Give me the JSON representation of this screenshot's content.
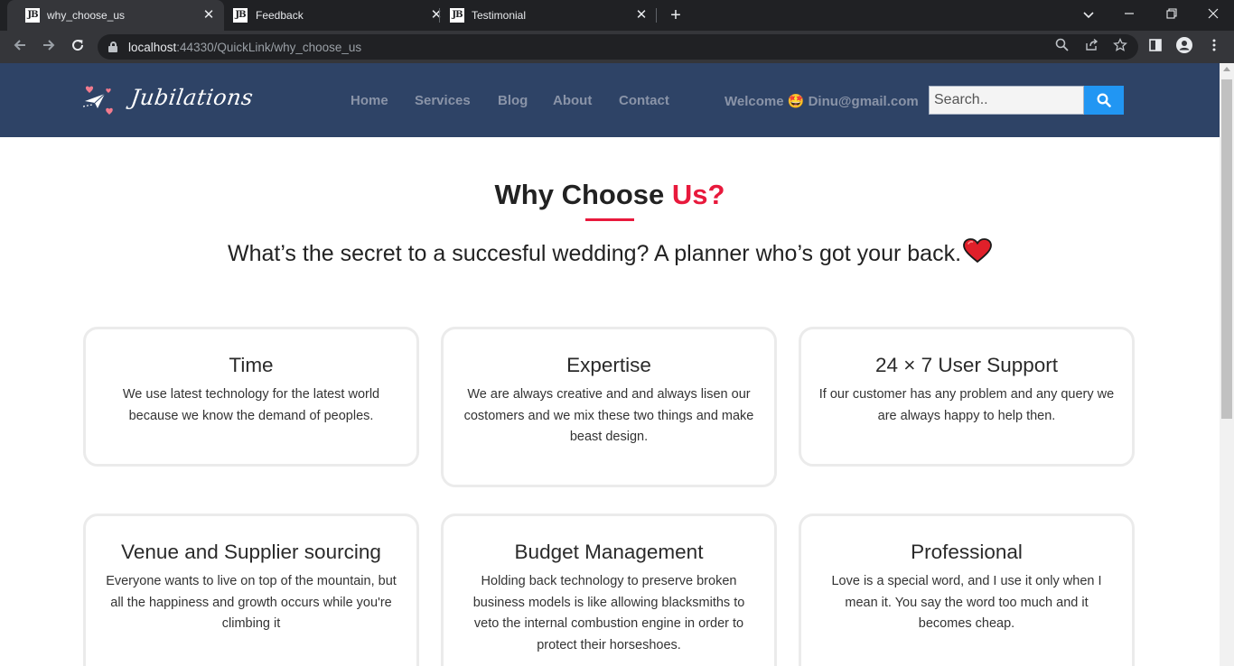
{
  "browser": {
    "tabs": [
      {
        "favicon": "JB",
        "title": "why_choose_us"
      },
      {
        "favicon": "JB",
        "title": "Feedback"
      },
      {
        "favicon": "JB",
        "title": "Testimonial"
      }
    ],
    "url_host": "localhost",
    "url_rest": ":44330/QuickLink/why_choose_us"
  },
  "site": {
    "logo_text": "Jubilations",
    "nav": [
      "Home",
      "Services",
      "Blog",
      "About",
      "Contact"
    ],
    "welcome": "Welcome 🤩 Dinu@gmail.com",
    "search_placeholder": "Search..",
    "colors": {
      "header": "#2e4366",
      "accent": "#e8193c",
      "search_button": "#2196f3"
    }
  },
  "section": {
    "title": "Why Choose ",
    "title_accent": "Us?",
    "tagline": "What’s the secret to a succesful wedding? A planner who’s got your back."
  },
  "cards": [
    {
      "title": "Time",
      "text": "We use latest technology for the latest world because we know the demand of peoples."
    },
    {
      "title": "Expertise",
      "text": "We are always creative and and always lisen our costomers and we mix these two things and make beast design."
    },
    {
      "title": "24 × 7 User Support",
      "text": "If our customer has any problem and any query we are always happy to help then."
    },
    {
      "title": "Venue and Supplier sourcing",
      "text": "Everyone wants to live on top of the mountain, but all the happiness and growth occurs while you're climbing it"
    },
    {
      "title": "Budget Management",
      "text": "Holding back technology to preserve broken business models is like allowing blacksmiths to veto the internal combustion engine in order to protect their horseshoes."
    },
    {
      "title": "Professional",
      "text": "Love is a special word, and I use it only when I mean it. You say the word too much and it becomes cheap."
    }
  ]
}
